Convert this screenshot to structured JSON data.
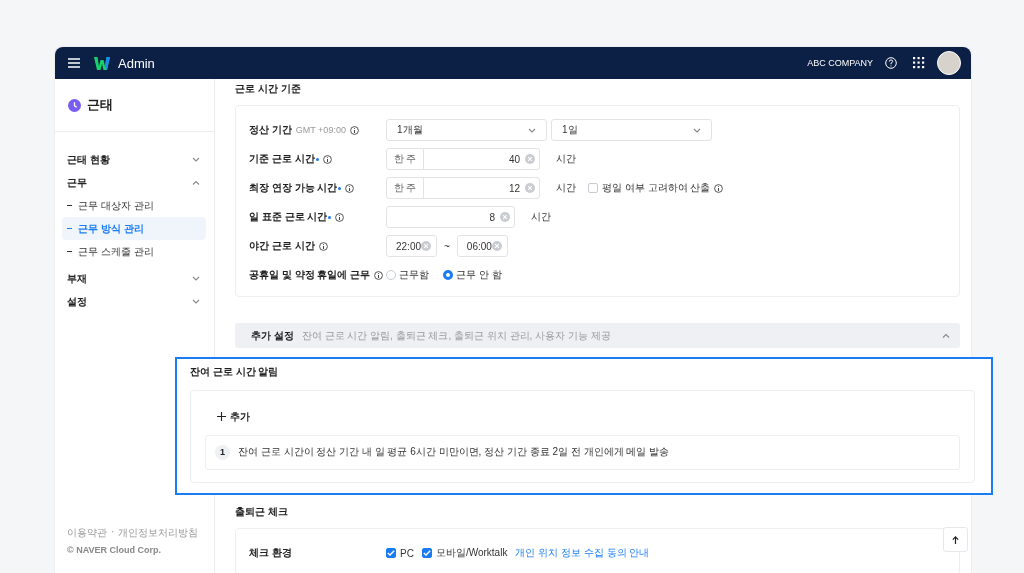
{
  "header": {
    "app_name": "Admin",
    "company": "ABC COMPANY"
  },
  "sidebar": {
    "title": "근태",
    "items": [
      {
        "label": "근태 현황",
        "expanded": false
      },
      {
        "label": "근무",
        "expanded": true,
        "children": [
          {
            "label": "근무 대상자 관리",
            "selected": false
          },
          {
            "label": "근무 방식 관리",
            "selected": true
          },
          {
            "label": "근무 스케줄 관리",
            "selected": false
          }
        ]
      },
      {
        "label": "부재",
        "expanded": false
      },
      {
        "label": "설정",
        "expanded": false
      }
    ],
    "footer_links": [
      "이용약관",
      "개인정보처리방침"
    ],
    "footer_separator": "·",
    "copyright": "© NAVER Cloud Corp."
  },
  "work_hours": {
    "title": "근로 시간 기준",
    "rows": [
      {
        "kind": "select",
        "label": "정산 기간",
        "required": false,
        "hint": "GMT +09:00",
        "selects": [
          "1개월",
          "1일"
        ]
      },
      {
        "kind": "number",
        "label": "기준 근로 시간",
        "required": true,
        "prefix": "한 주",
        "value": "40",
        "unit": "시간"
      },
      {
        "kind": "number",
        "label": "최장 연장 가능 시간",
        "required": true,
        "prefix": "한 주",
        "value": "12",
        "unit": "시간",
        "option": {
          "label": "평일 여부 고려하여 산출",
          "checked": false
        }
      },
      {
        "kind": "number",
        "label": "일 표준 근로 시간",
        "required": true,
        "value": "8",
        "unit": "시간"
      },
      {
        "kind": "range",
        "label": "야간 근로 시간",
        "required": false,
        "from": "22:00",
        "separator": "~",
        "to": "06:00"
      },
      {
        "kind": "radio",
        "label": "공휴일 및 약정 휴일에 근무",
        "required": false,
        "options": [
          {
            "label": "근무함",
            "selected": false
          },
          {
            "label": "근무 안 함",
            "selected": true
          }
        ]
      }
    ]
  },
  "additional_settings": {
    "title": "추가 설정",
    "summary": "잔여 근로 시간 알림, 출퇴근 체크, 출퇴근 위치 관리, 사용자 기능 제공",
    "expanded": true
  },
  "remaining_time_alert": {
    "title": "잔여 근로 시간 알림",
    "add_label": "추가",
    "rules": [
      {
        "number": "1",
        "text": "잔여 근로 시간이 정산 기간 내 일 평균 6시간 미만이면, 정산 기간 종료 2일 전 개인에게 메일 발송"
      }
    ]
  },
  "attendance_check": {
    "title": "출퇴근 체크",
    "rows": [
      {
        "label": "체크 환경",
        "options": [
          {
            "label": "PC",
            "checked": true
          },
          {
            "label": "모바일/Worktalk",
            "checked": true
          }
        ],
        "link": "개인 위치 정보 수집 동의 안내"
      }
    ]
  }
}
